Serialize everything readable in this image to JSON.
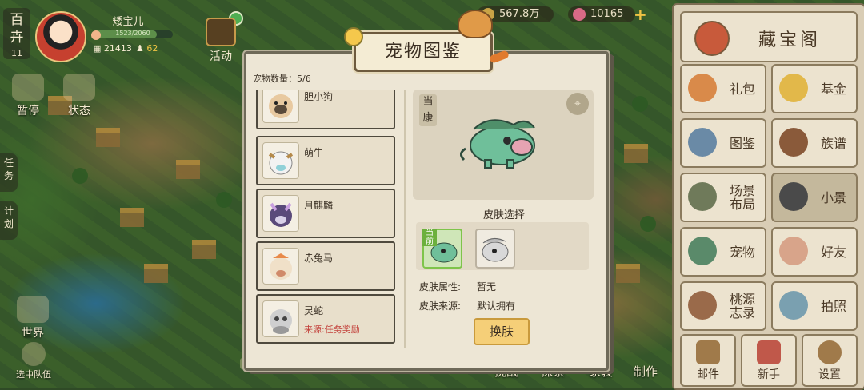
{
  "player": {
    "side_tab": "百\n卉",
    "level": "11",
    "name": "矮宝儿",
    "exp_text": "1523/2060",
    "exp_fraction": 0.8,
    "coins": "21413",
    "people": "62"
  },
  "top": {
    "huodong": "活动",
    "currency1": "567.8万",
    "currency2": "10165",
    "plus": "+"
  },
  "left": {
    "zhanting": "暂停",
    "zhuangtai": "状态",
    "renwu": "任\n务",
    "jihua": "计\n划",
    "shijie": "世界",
    "team": "选中队伍"
  },
  "bottom": {
    "tiaozhan": "挑战",
    "tansuo": "探索",
    "jiazhuang": "家装",
    "zhizuo": "制作"
  },
  "right_panel": {
    "cangbao": "藏宝阁",
    "buttons": [
      {
        "label": "礼包"
      },
      {
        "label": "基金"
      },
      {
        "label": "图鉴"
      },
      {
        "label": "族谱"
      },
      {
        "label": "场景\n布局"
      },
      {
        "label": "小景"
      },
      {
        "label": "宠物"
      },
      {
        "label": "好友"
      },
      {
        "label": "桃源\n志录"
      },
      {
        "label": "拍照"
      }
    ],
    "bottom_buttons": [
      {
        "label": "邮件"
      },
      {
        "label": "新手"
      },
      {
        "label": "设置"
      }
    ]
  },
  "book": {
    "title": "宠物图鉴",
    "count_label": "宠物数量：5/6",
    "pets": [
      {
        "name": "胆小狗",
        "source": ""
      },
      {
        "name": "萌牛",
        "source": ""
      },
      {
        "name": "月麒麟",
        "source": ""
      },
      {
        "name": "赤兔马",
        "source": ""
      },
      {
        "name": "灵蛇",
        "source": "来源:任务奖励"
      }
    ],
    "detail": {
      "current_tag": "当\n康",
      "skin_header": "皮肤选择",
      "skin_current_tag": "当前",
      "attr_label": "皮肤属性:",
      "attr_value": "暂无",
      "source_label": "皮肤来源:",
      "source_value": "默认拥有",
      "change_button": "换肤"
    }
  }
}
